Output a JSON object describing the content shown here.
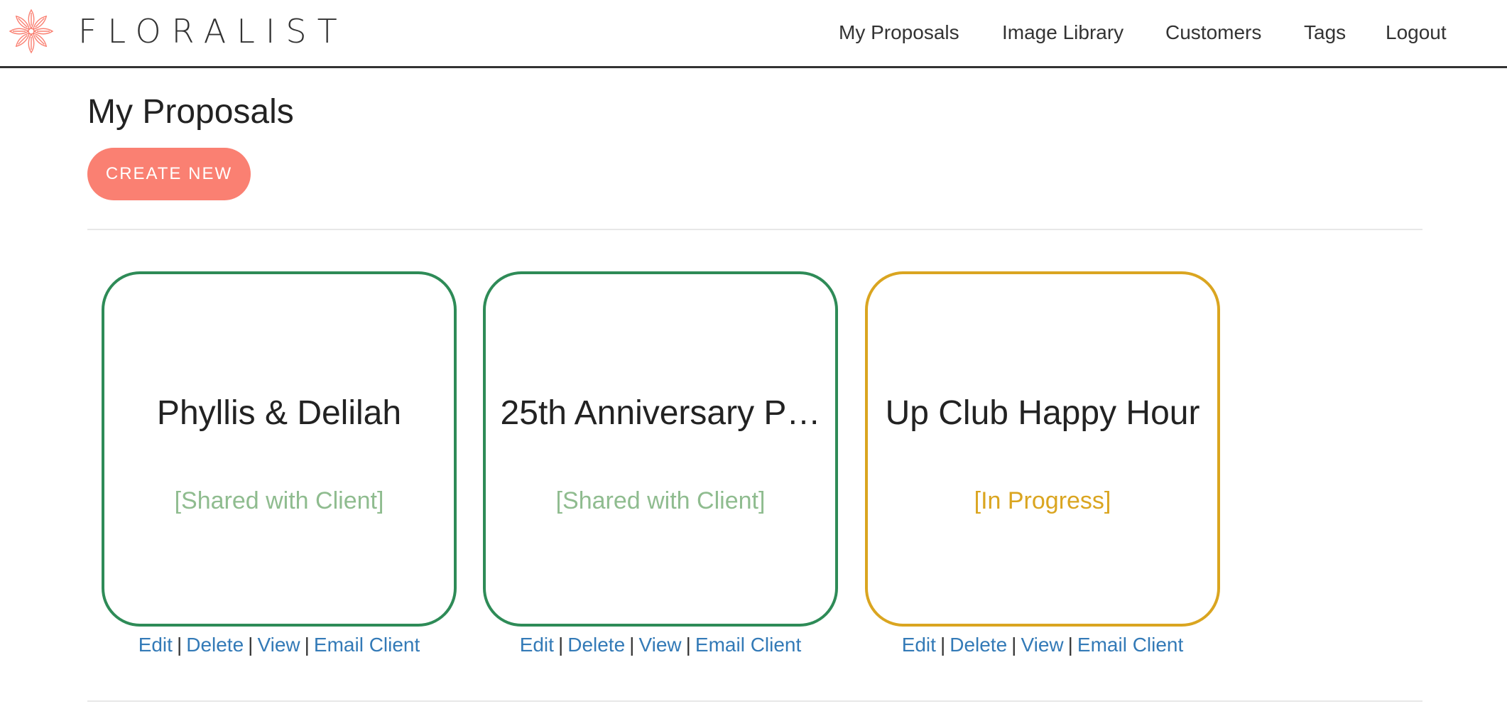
{
  "brand": {
    "name": "FLORALIST",
    "logo_icon": "flower-icon",
    "logo_color": "#fa8072"
  },
  "nav": {
    "items": [
      {
        "label": "My Proposals"
      },
      {
        "label": "Image Library"
      },
      {
        "label": "Customers"
      },
      {
        "label": "Tags"
      },
      {
        "label": "Logout"
      }
    ]
  },
  "page": {
    "title": "My Proposals",
    "create_button": "CREATE NEW",
    "accent_color": "#fa8072"
  },
  "proposals": [
    {
      "title": "Phyllis & Delilah",
      "status": "[Shared with Client]",
      "status_color": "#8fbc8f",
      "border_color": "#2e8b57"
    },
    {
      "title": "25th Anniversary P…",
      "status": "[Shared with Client]",
      "status_color": "#8fbc8f",
      "border_color": "#2e8b57"
    },
    {
      "title": "Up Club Happy Hour",
      "status": "[In Progress]",
      "status_color": "#daa520",
      "border_color": "#daa520"
    }
  ],
  "actions": {
    "edit": "Edit",
    "delete": "Delete",
    "view": "View",
    "email": "Email Client",
    "separator": "|"
  }
}
